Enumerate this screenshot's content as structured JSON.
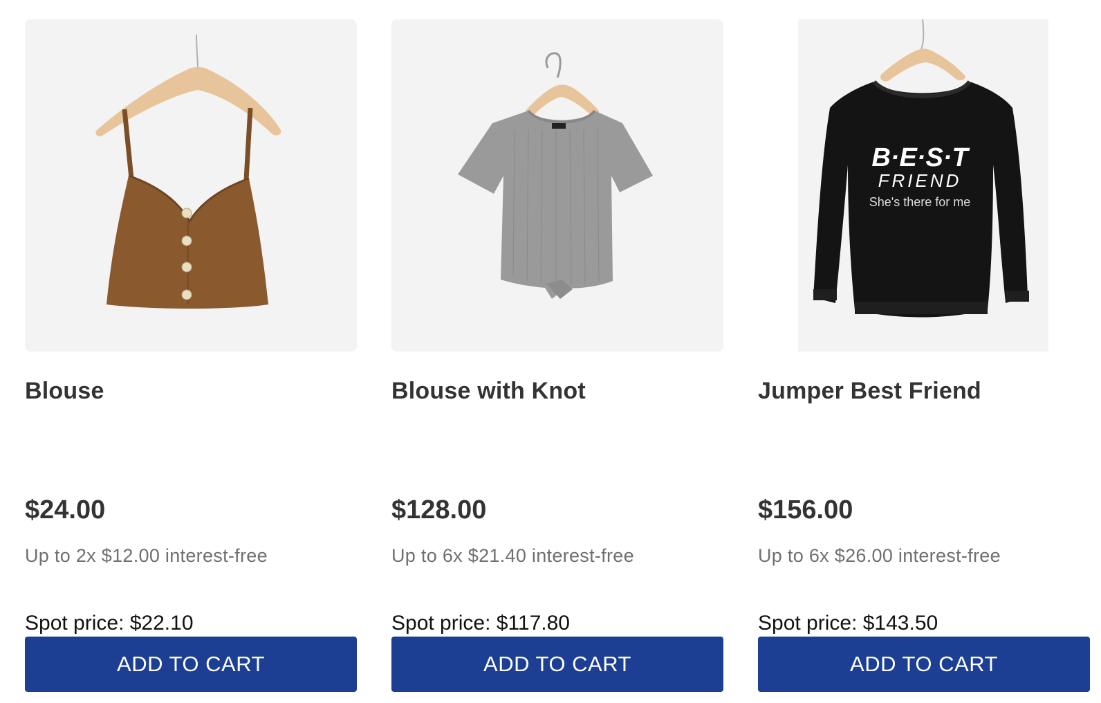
{
  "products": [
    {
      "name": "Blouse",
      "price": "$24.00",
      "installments": "Up to 2x $12.00 interest-free",
      "spot_price": "Spot price: $22.10",
      "cta": "ADD TO CART",
      "color": "#8a5a2e"
    },
    {
      "name": "Blouse with Knot",
      "price": "$128.00",
      "installments": "Up to 6x $21.40 interest-free",
      "spot_price": "Spot price: $117.80",
      "cta": "ADD TO CART",
      "color": "#9a9a9a"
    },
    {
      "name": "Jumper Best Friend",
      "price": "$156.00",
      "installments": "Up to 6x $26.00 interest-free",
      "spot_price": "Spot price: $143.50",
      "cta": "ADD TO CART",
      "color": "#141414",
      "print_text": {
        "line1": "B·E·S·T",
        "line2": "FRIEND",
        "line3": "She's there for me"
      }
    }
  ],
  "colors": {
    "button": "#1c3f94",
    "image_bg": "#f3f3f3",
    "hanger": "#e8c49a"
  }
}
